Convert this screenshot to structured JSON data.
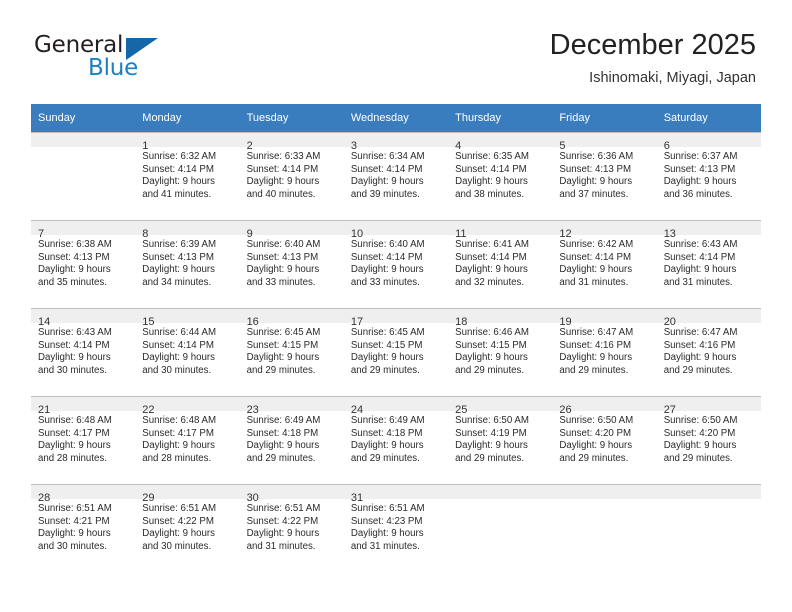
{
  "brand": {
    "word_one": "General",
    "word_two": "Blue",
    "mark": "triangle-logo"
  },
  "header": {
    "title": "December 2025",
    "subtitle": "Ishinomaki, Miyagi, Japan"
  },
  "calendar": {
    "weekday_headers": [
      "Sunday",
      "Monday",
      "Tuesday",
      "Wednesday",
      "Thursday",
      "Friday",
      "Saturday"
    ],
    "header_background": "#3a7dbf",
    "daynum_background": "#efefef",
    "weeks": [
      [
        {
          "day": "",
          "lines": []
        },
        {
          "day": "1",
          "lines": [
            "Sunrise: 6:32 AM",
            "Sunset: 4:14 PM",
            "Daylight: 9 hours",
            "and 41 minutes."
          ]
        },
        {
          "day": "2",
          "lines": [
            "Sunrise: 6:33 AM",
            "Sunset: 4:14 PM",
            "Daylight: 9 hours",
            "and 40 minutes."
          ]
        },
        {
          "day": "3",
          "lines": [
            "Sunrise: 6:34 AM",
            "Sunset: 4:14 PM",
            "Daylight: 9 hours",
            "and 39 minutes."
          ]
        },
        {
          "day": "4",
          "lines": [
            "Sunrise: 6:35 AM",
            "Sunset: 4:14 PM",
            "Daylight: 9 hours",
            "and 38 minutes."
          ]
        },
        {
          "day": "5",
          "lines": [
            "Sunrise: 6:36 AM",
            "Sunset: 4:13 PM",
            "Daylight: 9 hours",
            "and 37 minutes."
          ]
        },
        {
          "day": "6",
          "lines": [
            "Sunrise: 6:37 AM",
            "Sunset: 4:13 PM",
            "Daylight: 9 hours",
            "and 36 minutes."
          ]
        }
      ],
      [
        {
          "day": "7",
          "lines": [
            "Sunrise: 6:38 AM",
            "Sunset: 4:13 PM",
            "Daylight: 9 hours",
            "and 35 minutes."
          ]
        },
        {
          "day": "8",
          "lines": [
            "Sunrise: 6:39 AM",
            "Sunset: 4:13 PM",
            "Daylight: 9 hours",
            "and 34 minutes."
          ]
        },
        {
          "day": "9",
          "lines": [
            "Sunrise: 6:40 AM",
            "Sunset: 4:13 PM",
            "Daylight: 9 hours",
            "and 33 minutes."
          ]
        },
        {
          "day": "10",
          "lines": [
            "Sunrise: 6:40 AM",
            "Sunset: 4:14 PM",
            "Daylight: 9 hours",
            "and 33 minutes."
          ]
        },
        {
          "day": "11",
          "lines": [
            "Sunrise: 6:41 AM",
            "Sunset: 4:14 PM",
            "Daylight: 9 hours",
            "and 32 minutes."
          ]
        },
        {
          "day": "12",
          "lines": [
            "Sunrise: 6:42 AM",
            "Sunset: 4:14 PM",
            "Daylight: 9 hours",
            "and 31 minutes."
          ]
        },
        {
          "day": "13",
          "lines": [
            "Sunrise: 6:43 AM",
            "Sunset: 4:14 PM",
            "Daylight: 9 hours",
            "and 31 minutes."
          ]
        }
      ],
      [
        {
          "day": "14",
          "lines": [
            "Sunrise: 6:43 AM",
            "Sunset: 4:14 PM",
            "Daylight: 9 hours",
            "and 30 minutes."
          ]
        },
        {
          "day": "15",
          "lines": [
            "Sunrise: 6:44 AM",
            "Sunset: 4:14 PM",
            "Daylight: 9 hours",
            "and 30 minutes."
          ]
        },
        {
          "day": "16",
          "lines": [
            "Sunrise: 6:45 AM",
            "Sunset: 4:15 PM",
            "Daylight: 9 hours",
            "and 29 minutes."
          ]
        },
        {
          "day": "17",
          "lines": [
            "Sunrise: 6:45 AM",
            "Sunset: 4:15 PM",
            "Daylight: 9 hours",
            "and 29 minutes."
          ]
        },
        {
          "day": "18",
          "lines": [
            "Sunrise: 6:46 AM",
            "Sunset: 4:15 PM",
            "Daylight: 9 hours",
            "and 29 minutes."
          ]
        },
        {
          "day": "19",
          "lines": [
            "Sunrise: 6:47 AM",
            "Sunset: 4:16 PM",
            "Daylight: 9 hours",
            "and 29 minutes."
          ]
        },
        {
          "day": "20",
          "lines": [
            "Sunrise: 6:47 AM",
            "Sunset: 4:16 PM",
            "Daylight: 9 hours",
            "and 29 minutes."
          ]
        }
      ],
      [
        {
          "day": "21",
          "lines": [
            "Sunrise: 6:48 AM",
            "Sunset: 4:17 PM",
            "Daylight: 9 hours",
            "and 28 minutes."
          ]
        },
        {
          "day": "22",
          "lines": [
            "Sunrise: 6:48 AM",
            "Sunset: 4:17 PM",
            "Daylight: 9 hours",
            "and 28 minutes."
          ]
        },
        {
          "day": "23",
          "lines": [
            "Sunrise: 6:49 AM",
            "Sunset: 4:18 PM",
            "Daylight: 9 hours",
            "and 29 minutes."
          ]
        },
        {
          "day": "24",
          "lines": [
            "Sunrise: 6:49 AM",
            "Sunset: 4:18 PM",
            "Daylight: 9 hours",
            "and 29 minutes."
          ]
        },
        {
          "day": "25",
          "lines": [
            "Sunrise: 6:50 AM",
            "Sunset: 4:19 PM",
            "Daylight: 9 hours",
            "and 29 minutes."
          ]
        },
        {
          "day": "26",
          "lines": [
            "Sunrise: 6:50 AM",
            "Sunset: 4:20 PM",
            "Daylight: 9 hours",
            "and 29 minutes."
          ]
        },
        {
          "day": "27",
          "lines": [
            "Sunrise: 6:50 AM",
            "Sunset: 4:20 PM",
            "Daylight: 9 hours",
            "and 29 minutes."
          ]
        }
      ],
      [
        {
          "day": "28",
          "lines": [
            "Sunrise: 6:51 AM",
            "Sunset: 4:21 PM",
            "Daylight: 9 hours",
            "and 30 minutes."
          ]
        },
        {
          "day": "29",
          "lines": [
            "Sunrise: 6:51 AM",
            "Sunset: 4:22 PM",
            "Daylight: 9 hours",
            "and 30 minutes."
          ]
        },
        {
          "day": "30",
          "lines": [
            "Sunrise: 6:51 AM",
            "Sunset: 4:22 PM",
            "Daylight: 9 hours",
            "and 31 minutes."
          ]
        },
        {
          "day": "31",
          "lines": [
            "Sunrise: 6:51 AM",
            "Sunset: 4:23 PM",
            "Daylight: 9 hours",
            "and 31 minutes."
          ]
        },
        {
          "day": "",
          "lines": []
        },
        {
          "day": "",
          "lines": []
        },
        {
          "day": "",
          "lines": []
        }
      ]
    ]
  }
}
